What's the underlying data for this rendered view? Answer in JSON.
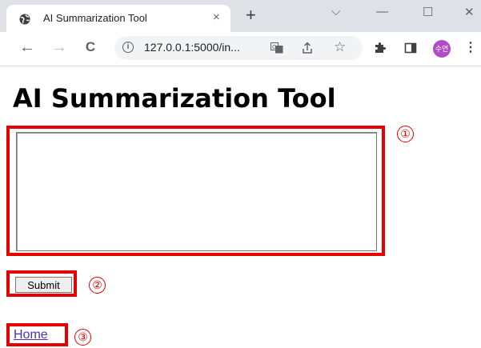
{
  "browser": {
    "tab_title": "AI Summarization Tool",
    "tab_close": "×",
    "new_tab": "+",
    "window_controls": {
      "tabs_dropdown": "⌵",
      "minimize": "—",
      "maximize": "☐",
      "close": "✕"
    },
    "nav": {
      "back": "←",
      "forward": "→",
      "reload": "C"
    },
    "url": "127.0.0.1:5000/in...",
    "avatar_text": "수연",
    "menu": "⋮"
  },
  "page": {
    "title": "AI Summarization Tool",
    "textarea_value": "",
    "submit_label": "Submit",
    "home_link": "Home"
  },
  "annotations": [
    "①",
    "②",
    "③"
  ],
  "colors": {
    "annotation": "#e60000",
    "link": "#4d2fb8",
    "avatar": "#b04cc7"
  }
}
